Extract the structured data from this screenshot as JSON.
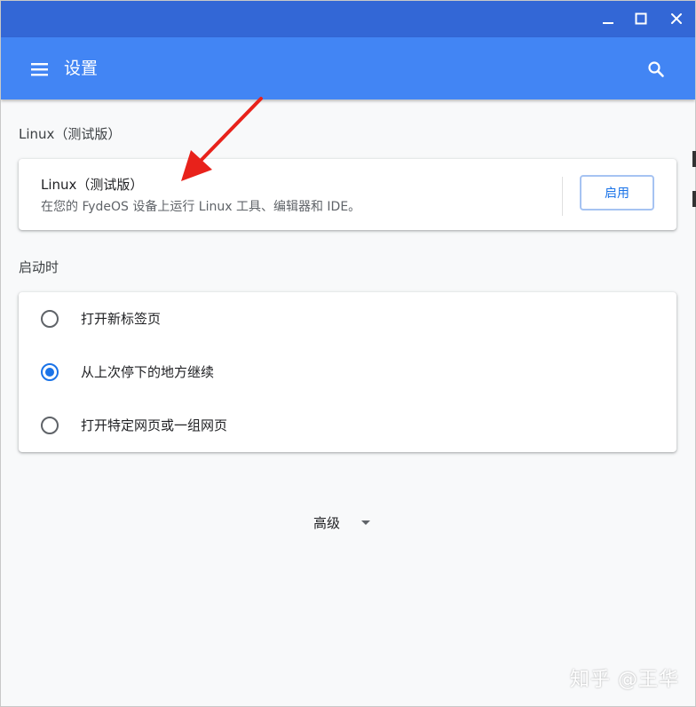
{
  "app": {
    "title": "设置"
  },
  "window_controls": {
    "minimize": "minimize",
    "maximize": "maximize",
    "close": "close"
  },
  "linux_section": {
    "heading": "Linux（测试版）",
    "card_title": "Linux（测试版）",
    "card_description": "在您的 FydeOS 设备上运行 Linux 工具、编辑器和 IDE。",
    "enable_button": "启用"
  },
  "startup_section": {
    "heading": "启动时",
    "options": [
      {
        "label": "打开新标签页",
        "checked": false
      },
      {
        "label": "从上次停下的地方继续",
        "checked": true
      },
      {
        "label": "打开特定网页或一组网页",
        "checked": false
      }
    ]
  },
  "advanced": {
    "label": "高级"
  },
  "watermark": "知乎 @王华",
  "colors": {
    "titlebar": "#3367d6",
    "appbar": "#4285f4",
    "accent": "#1a73e8",
    "annotation_arrow": "#e8221b"
  },
  "icons": {
    "menu": "hamburger-menu-icon",
    "search": "search-icon",
    "advanced": "caret-down-icon"
  }
}
